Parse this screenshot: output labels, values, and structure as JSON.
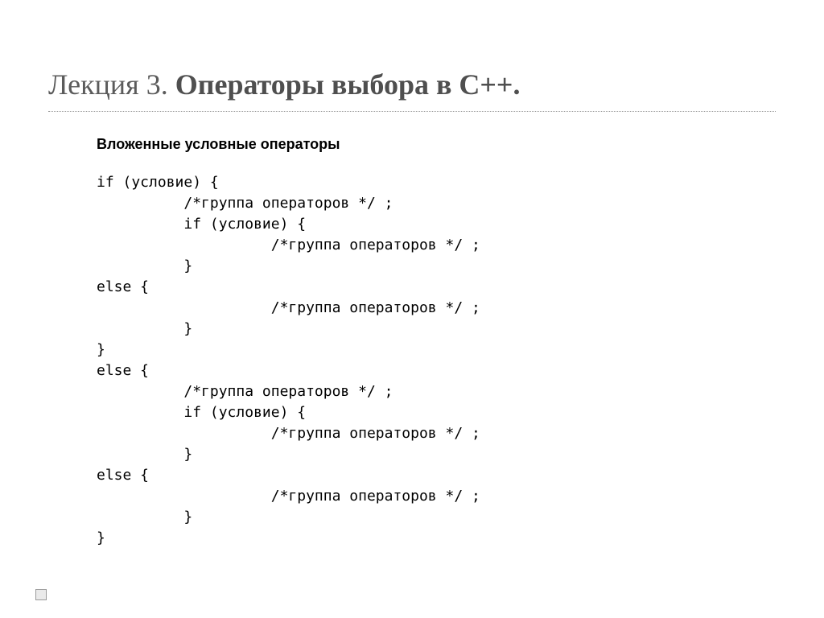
{
  "title": {
    "light_part": "Лекция 3. ",
    "bold_part": "Операторы выбора в С++."
  },
  "subtitle": "Вложенные условные операторы",
  "code_lines": [
    "if (условие) {",
    "          /*группа операторов */ ;",
    "          if (условие) {",
    "                    /*группа операторов */ ;",
    "          }",
    "else {",
    "                    /*группа операторов */ ;",
    "          }",
    "}",
    "else {",
    "          /*группа операторов */ ;",
    "          if (условие) {",
    "                    /*группа операторов */ ;",
    "          }",
    "else {",
    "                    /*группа операторов */ ;",
    "          }",
    "}"
  ]
}
